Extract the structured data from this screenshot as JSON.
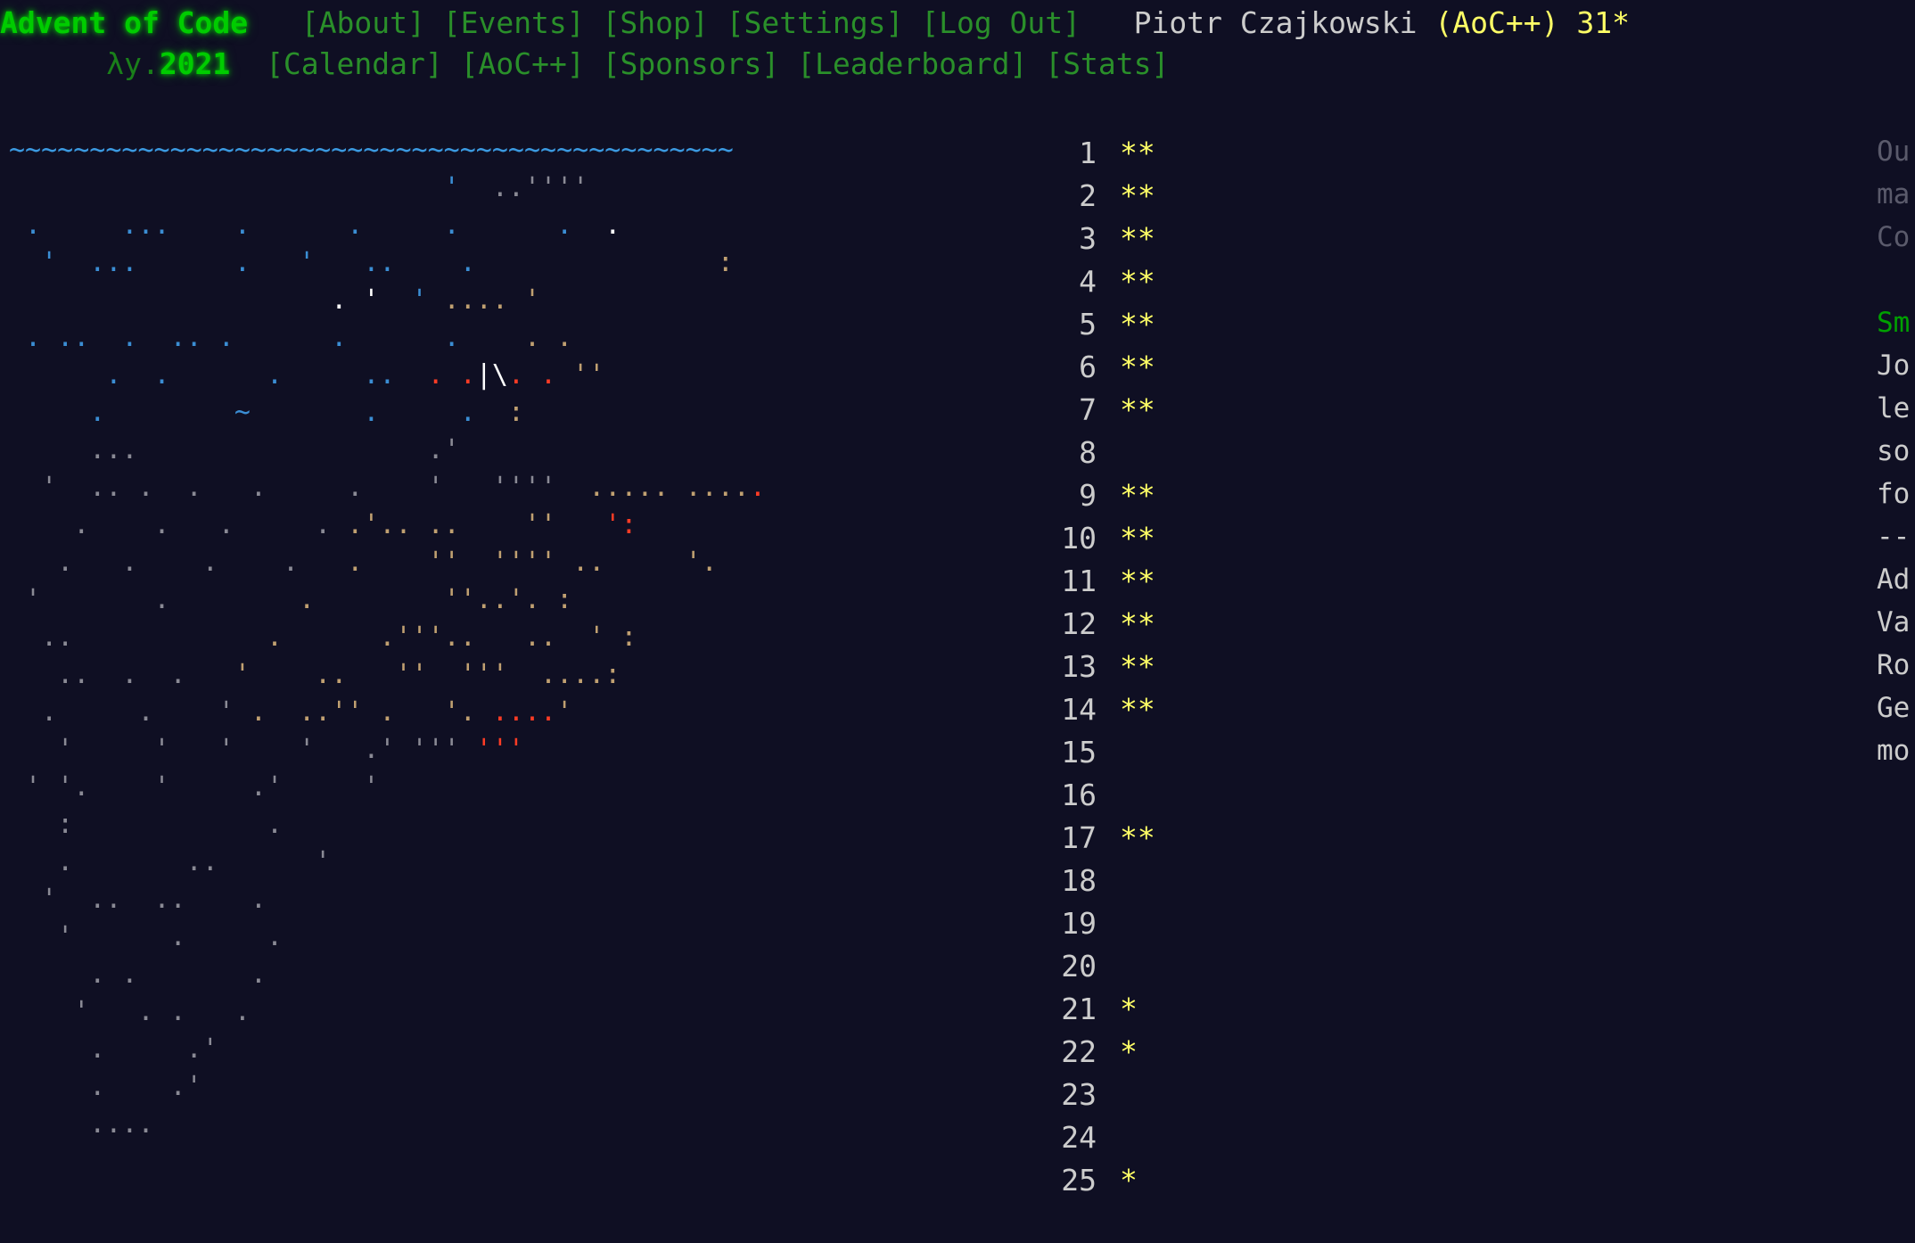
{
  "page": {
    "background": "#0f0f23",
    "title": "Advent of Code 2021",
    "star_color": "#ffff66",
    "accent_green": "#00cc00",
    "nav_green": "#2a8f2a"
  },
  "header": {
    "logo": "Advent of Code",
    "logo_lambda": "λy.",
    "logo_year": "2021",
    "nav_row1": [
      {
        "label": "[About]",
        "name": "nav-about"
      },
      {
        "label": "[Events]",
        "name": "nav-events"
      },
      {
        "label": "[Shop]",
        "name": "nav-shop"
      },
      {
        "label": "[Settings]",
        "name": "nav-settings"
      },
      {
        "label": "[Log Out]",
        "name": "nav-log-out"
      }
    ],
    "nav_row2": [
      {
        "label": "[Calendar]",
        "name": "nav-calendar"
      },
      {
        "label": "[AoC++]",
        "name": "nav-aocpp"
      },
      {
        "label": "[Sponsors]",
        "name": "nav-sponsors"
      },
      {
        "label": "[Leaderboard]",
        "name": "nav-leaderboard"
      },
      {
        "label": "[Stats]",
        "name": "nav-stats"
      }
    ],
    "user": {
      "name": "Piotr Czajkowski",
      "badge": "(AoC++)",
      "stars": "31*"
    }
  },
  "calendar": {
    "total_stars": 31,
    "days": [
      {
        "day": "1",
        "stars": "**"
      },
      {
        "day": "2",
        "stars": "**"
      },
      {
        "day": "3",
        "stars": "**"
      },
      {
        "day": "4",
        "stars": "**"
      },
      {
        "day": "5",
        "stars": "**"
      },
      {
        "day": "6",
        "stars": "**"
      },
      {
        "day": "7",
        "stars": "**"
      },
      {
        "day": "8",
        "stars": ""
      },
      {
        "day": "9",
        "stars": "**"
      },
      {
        "day": "10",
        "stars": "**"
      },
      {
        "day": "11",
        "stars": "**"
      },
      {
        "day": "12",
        "stars": "**"
      },
      {
        "day": "13",
        "stars": "**"
      },
      {
        "day": "14",
        "stars": "**"
      },
      {
        "day": "15",
        "stars": ""
      },
      {
        "day": "16",
        "stars": ""
      },
      {
        "day": "17",
        "stars": "**"
      },
      {
        "day": "18",
        "stars": ""
      },
      {
        "day": "19",
        "stars": ""
      },
      {
        "day": "20",
        "stars": ""
      },
      {
        "day": "21",
        "stars": "*"
      },
      {
        "day": "22",
        "stars": "*"
      },
      {
        "day": "23",
        "stars": ""
      },
      {
        "day": "24",
        "stars": ""
      },
      {
        "day": "25",
        "stars": "*"
      }
    ]
  },
  "art": {
    "description": "ocean-trench-ascii-art",
    "rows": [
      [
        {
          "t": "~~~~~~~~~~~~~~~~~~~~~~~~~~~~~~~~~~~~~~~~~~~~~",
          "c": "c-wave"
        }
      ],
      [
        {
          "t": "                           ",
          "c": "c-dark"
        },
        {
          "t": "'",
          "c": "c-blue"
        },
        {
          "t": "  ..''''",
          "c": "c-gray"
        }
      ],
      [
        {
          "t": " .     ...    .      .     .      .",
          "c": "c-blue"
        },
        {
          "t": "  ",
          "c": "c-dark"
        },
        {
          "t": ".",
          "c": "c-white"
        }
      ],
      [
        {
          "t": "  '  ...      .   '   ..    .",
          "c": "c-blue"
        },
        {
          "t": "               ",
          "c": "c-dark"
        },
        {
          "t": ":",
          "c": "c-tan"
        }
      ],
      [
        {
          "t": "                    ",
          "c": "c-dark"
        },
        {
          "t": ".",
          "c": "c-white"
        },
        {
          "t": " '",
          "c": "c-white"
        },
        {
          "t": "  ",
          "c": "c-dark"
        },
        {
          "t": "'",
          "c": "c-blue"
        },
        {
          "t": " ....",
          "c": "c-tan"
        },
        {
          "t": " '",
          "c": "c-tan"
        }
      ],
      [
        {
          "t": " . ..  .  .. .      .      .",
          "c": "c-blue"
        },
        {
          "t": "    ",
          "c": "c-dark"
        },
        {
          "t": ". .",
          "c": "c-tan"
        }
      ],
      [
        {
          "t": "      .  .      .     ..  ",
          "c": "c-blue"
        },
        {
          "t": ". .",
          "c": "c-red"
        },
        {
          "t": "|\\",
          "c": "c-white"
        },
        {
          "t": ". .",
          "c": "c-red"
        },
        {
          "t": " ''",
          "c": "c-tan"
        }
      ],
      [
        {
          "t": "     .        ~       .     .",
          "c": "c-blue"
        },
        {
          "t": "  :",
          "c": "c-tan"
        }
      ],
      [
        {
          "t": "     ...                  .'",
          "c": "c-gray"
        }
      ],
      [
        {
          "t": "  '  .. .  .   .     .    '   ''''",
          "c": "c-gray"
        },
        {
          "t": "  ..... ....",
          "c": "c-tan"
        },
        {
          "t": ".",
          "c": "c-red"
        }
      ],
      [
        {
          "t": "    .    .   .     . ",
          "c": "c-gray"
        },
        {
          "t": ".'.. ..    ''",
          "c": "c-tan"
        },
        {
          "t": "   ':",
          "c": "c-red"
        }
      ],
      [
        {
          "t": "   .   .    .    .   ",
          "c": "c-gray"
        },
        {
          "t": ".    ''  '''' ..",
          "c": "c-tan"
        },
        {
          "t": "     '.",
          "c": "c-tan"
        }
      ],
      [
        {
          "t": " '       .        ",
          "c": "c-gray"
        },
        {
          "t": ".        ''..'. :",
          "c": "c-tan"
        }
      ],
      [
        {
          "t": "  ..            ",
          "c": "c-gray"
        },
        {
          "t": ".      .'''..   ..  ' :",
          "c": "c-tan"
        }
      ],
      [
        {
          "t": "   ..  .  .   ",
          "c": "c-gray"
        },
        {
          "t": "'    ..   ''  '''  ....:",
          "c": "c-tan"
        }
      ],
      [
        {
          "t": "  .     .    '",
          "c": "c-gray"
        },
        {
          "t": " .  ..'' .   '.",
          "c": "c-tan"
        },
        {
          "t": " ....",
          "c": "c-red"
        },
        {
          "t": "'",
          "c": "c-tan"
        }
      ],
      [
        {
          "t": "   '     '   '    '   .' ''' ",
          "c": "c-gray"
        },
        {
          "t": "'''",
          "c": "c-red"
        }
      ],
      [
        {
          "t": " ' '.    '     .'     '",
          "c": "c-gray"
        }
      ],
      [
        {
          "t": "   :            .",
          "c": "c-gray"
        }
      ],
      [
        {
          "t": "   .       ..      '",
          "c": "c-gray"
        }
      ],
      [
        {
          "t": "  '  ..  ..    .",
          "c": "c-gray"
        }
      ],
      [
        {
          "t": "   '      .     .",
          "c": "c-gray"
        }
      ],
      [
        {
          "t": "     . .       .",
          "c": "c-gray"
        }
      ],
      [
        {
          "t": "    '   . .   .",
          "c": "c-gray"
        }
      ],
      [
        {
          "t": "     .     .'",
          "c": "c-gray"
        }
      ],
      [
        {
          "t": "     .    .'",
          "c": "c-gray"
        }
      ],
      [
        {
          "t": "     ....",
          "c": "c-gray"
        }
      ]
    ]
  },
  "sidebar": {
    "rows": [
      {
        "t": "Ou",
        "c": "side-muted"
      },
      {
        "t": "ma",
        "c": "side-muted"
      },
      {
        "t": "Co",
        "c": "side-muted"
      },
      {
        "t": "",
        "c": "side-muted"
      },
      {
        "t": "Sm",
        "c": "side-green"
      },
      {
        "t": "Jo",
        "c": "side-text"
      },
      {
        "t": "le",
        "c": "side-text"
      },
      {
        "t": "so",
        "c": "side-text"
      },
      {
        "t": "fo",
        "c": "side-text"
      },
      {
        "t": "--",
        "c": "side-rule"
      },
      {
        "t": "Ad",
        "c": "side-text"
      },
      {
        "t": "Va",
        "c": "side-text"
      },
      {
        "t": "Ro",
        "c": "side-text"
      },
      {
        "t": "Ge",
        "c": "side-text"
      },
      {
        "t": "mo",
        "c": "side-text"
      }
    ]
  }
}
